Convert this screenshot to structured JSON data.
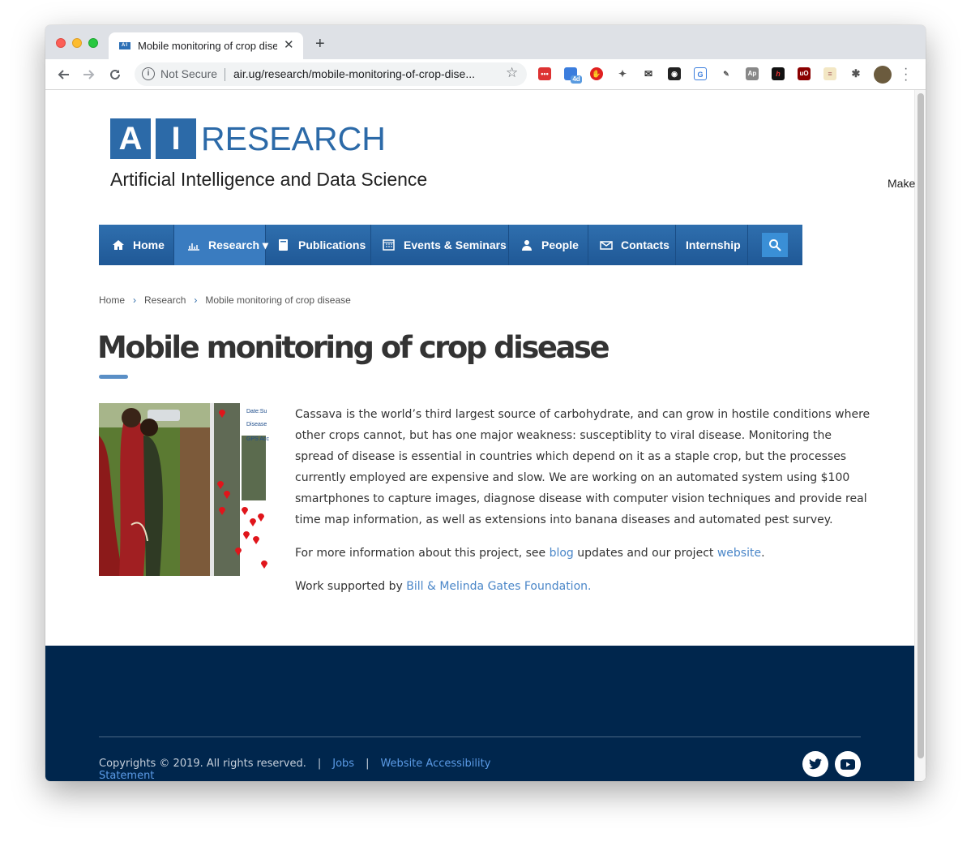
{
  "browser": {
    "tab_title": "Mobile monitoring of crop disease",
    "tab_favicon": "AI",
    "new_tab": "+",
    "close": "✕",
    "security": "Not Secure",
    "url": "air.ug/research/mobile-monitoring-of-crop-dise...",
    "extension_badge": "4d"
  },
  "site": {
    "logo_a": "A",
    "logo_i": "I",
    "logo_research": "RESEARCH",
    "tagline": "Artificial Intelligence and Data Science",
    "make": "Make",
    "brand_color": "#2c6aa8"
  },
  "nav": {
    "items": [
      {
        "label": "Home",
        "icon": "home-icon"
      },
      {
        "label": "Research ▾",
        "icon": "chart-icon"
      },
      {
        "label": "Publications",
        "icon": "book-icon"
      },
      {
        "label": "Events & Seminars",
        "icon": "calendar-icon"
      },
      {
        "label": "People",
        "icon": "person-icon"
      },
      {
        "label": "Contacts",
        "icon": "envelope-icon"
      },
      {
        "label": "Internship",
        "icon": ""
      }
    ],
    "search_icon": "🔍︎"
  },
  "breadcrumb": {
    "home": "Home",
    "research": "Research",
    "current": "Mobile monitoring of crop disease",
    "separator": "›"
  },
  "page": {
    "title": "Mobile monitoring of crop disease",
    "image_labels": [
      "Date:Su",
      "Disease",
      "GPS Acc"
    ],
    "paragraph1": "Cassava is the world’s third largest source of carbohydrate, and can grow in hostile conditions where other crops cannot, but has one major weakness: susceptiblity to viral disease. Monitoring the spread of disease is essential in countries which depend on it as a staple crop, but the processes currently employed are expensive and slow. We are working on an automated system using $100 smartphones to capture images, diagnose disease with computer vision techniques and provide real time map information, as well as extensions into banana diseases and automated pest survey.",
    "p2_before": "For more information about this project, see ",
    "p2_link1": "blog",
    "p2_middle": " updates and our project ",
    "p2_link2": "website",
    "p2_after": ".",
    "p3_before": "Work supported by ",
    "p3_link": "Bill & Melinda Gates Foundation."
  },
  "footer": {
    "copyright": "Copyrights © 2019. All rights reserved.",
    "pipe": "|",
    "jobs": "Jobs",
    "accessibility": "Website Accessibility",
    "statement": "Statement",
    "bg_color": "#00264d"
  }
}
